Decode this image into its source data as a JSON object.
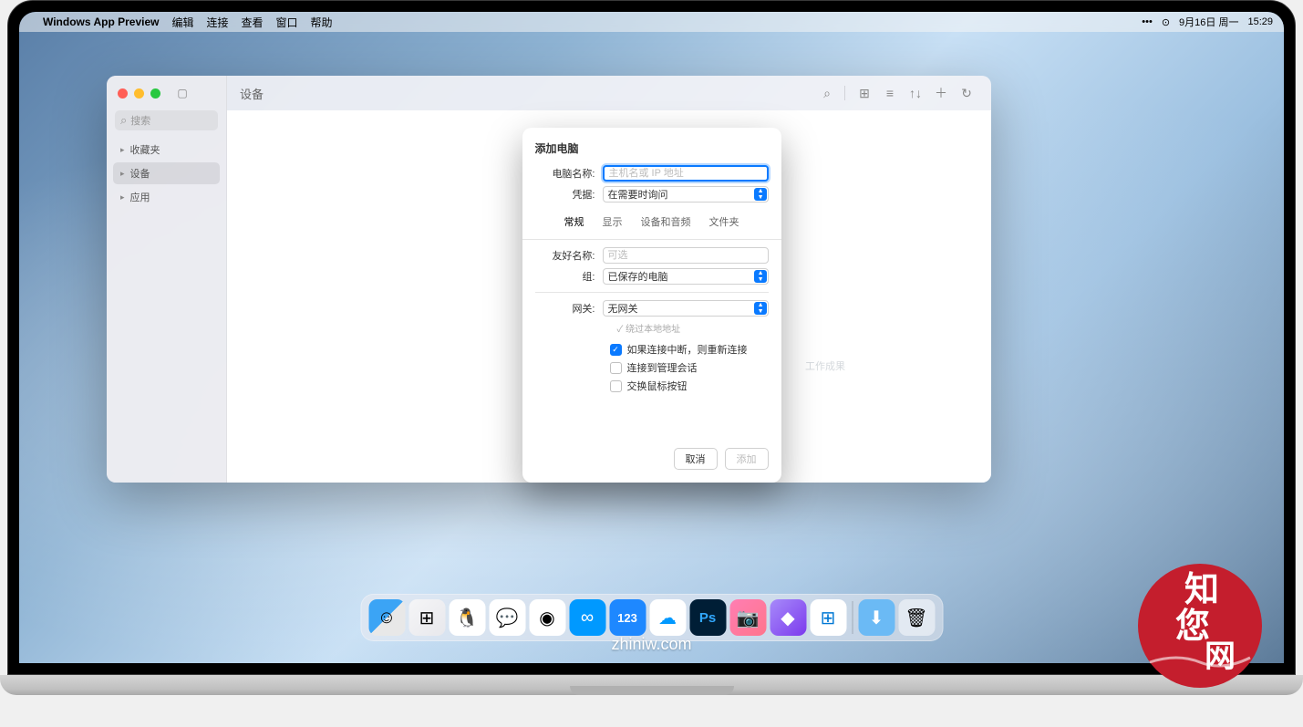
{
  "menubar": {
    "app_name": "Windows App Preview",
    "menus": [
      "编辑",
      "连接",
      "查看",
      "窗口",
      "帮助"
    ],
    "status": {
      "date": "9月16日 周一",
      "time": "15:29"
    }
  },
  "app_window": {
    "title": "设备",
    "search_placeholder": "搜索",
    "sidebar": {
      "items": [
        {
          "label": "收藏夹"
        },
        {
          "label": "设备"
        },
        {
          "label": "应用"
        }
      ]
    },
    "content_hint": "工作成果"
  },
  "modal": {
    "title": "添加电脑",
    "fields": {
      "pc_name_label": "电脑名称:",
      "pc_name_placeholder": "主机名或 IP 地址",
      "credential_label": "凭据:",
      "credential_value": "在需要时询问",
      "tabs": [
        "常规",
        "显示",
        "设备和音频",
        "文件夹"
      ],
      "active_tab": "常规",
      "friendly_label": "友好名称:",
      "friendly_placeholder": "可选",
      "group_label": "组:",
      "group_value": "已保存的电脑",
      "gateway_label": "网关:",
      "gateway_value": "无网关",
      "bypass_label": "绕过本地地址",
      "checkbox1": "如果连接中断，则重新连接",
      "checkbox2": "连接到管理会话",
      "checkbox3": "交换鼠标按钮"
    },
    "buttons": {
      "cancel": "取消",
      "add": "添加"
    }
  },
  "dock": {
    "items": [
      {
        "name": "finder",
        "glyph": "☺"
      },
      {
        "name": "launchpad",
        "glyph": "⊞"
      },
      {
        "name": "qq",
        "glyph": "🐧"
      },
      {
        "name": "wechat",
        "glyph": "💬"
      },
      {
        "name": "chrome",
        "glyph": "◉"
      },
      {
        "name": "baidu-disk",
        "glyph": "∞"
      },
      {
        "name": "123pan",
        "glyph": "123"
      },
      {
        "name": "cloud",
        "glyph": "☁"
      },
      {
        "name": "photoshop",
        "glyph": "Ps"
      },
      {
        "name": "cleanshot",
        "glyph": "📷"
      },
      {
        "name": "app-purple",
        "glyph": "◆"
      },
      {
        "name": "windows-app",
        "glyph": "⊞"
      },
      {
        "name": "downloads",
        "glyph": "⬇"
      },
      {
        "name": "trash",
        "glyph": "🗑"
      }
    ]
  },
  "footer": "zhiniw.com",
  "watermark": {
    "line1": "知",
    "line2": "您",
    "line3": "网"
  }
}
